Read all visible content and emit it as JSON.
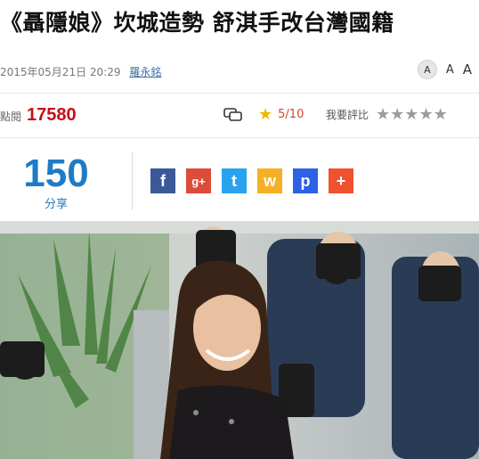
{
  "article": {
    "title": "《聶隱娘》坎城造勢 舒淇手改台灣國籍",
    "date": "2015年05月21日 20:29",
    "author": "羅永銘"
  },
  "font_size": {
    "small": "A",
    "medium": "A",
    "large": "A"
  },
  "stats": {
    "views_label": "點閱",
    "views": "17580",
    "rating_score": "5/10",
    "rate_me_label": "我要評比",
    "stars": [
      "☆",
      "☆",
      "☆",
      "☆",
      "☆"
    ]
  },
  "share": {
    "count": "150",
    "label": "分享",
    "buttons": [
      {
        "icon": "facebook-icon",
        "glyph": "f",
        "color": "#3b5998"
      },
      {
        "icon": "google-plus-icon",
        "glyph": "g+",
        "color": "#dd4b39"
      },
      {
        "icon": "twitter-icon",
        "glyph": "t",
        "color": "#2aa3ef"
      },
      {
        "icon": "weibo-icon",
        "glyph": "w",
        "color": "#f5b026"
      },
      {
        "icon": "paw-icon",
        "glyph": "p",
        "color": "#2d61e6"
      },
      {
        "icon": "plus-icon",
        "glyph": "+",
        "color": "#f0512e"
      }
    ]
  },
  "colors": {
    "views": "#c40f16",
    "share": "#1e7bc6",
    "star_gold": "#f2b600"
  }
}
